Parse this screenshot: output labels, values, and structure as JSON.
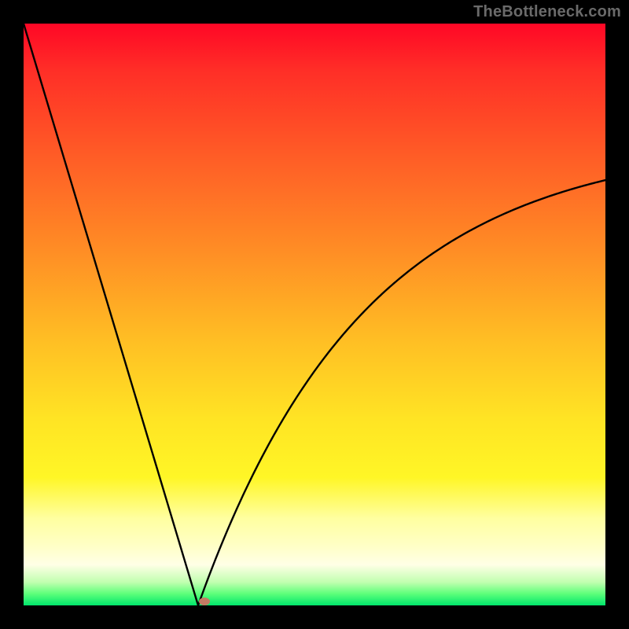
{
  "watermark": "TheBottleneck.com",
  "marker": {
    "x_frac": 0.311,
    "y_frac": 0.993
  },
  "chart_data": {
    "type": "line",
    "title": "",
    "xlabel": "",
    "ylabel": "",
    "xlim": [
      0,
      1
    ],
    "ylim": [
      0,
      1
    ],
    "x0": 0.3,
    "series": [
      {
        "name": "bottleneck-curve",
        "x": [
          0.0,
          0.05,
          0.1,
          0.15,
          0.2,
          0.25,
          0.28,
          0.3,
          0.32,
          0.35,
          0.4,
          0.45,
          0.5,
          0.55,
          0.6,
          0.65,
          0.7,
          0.75,
          0.8,
          0.85,
          0.9,
          0.95,
          1.0
        ],
        "y": [
          1.0,
          0.84,
          0.67,
          0.5,
          0.33,
          0.17,
          0.07,
          0.0,
          0.07,
          0.18,
          0.33,
          0.44,
          0.53,
          0.6,
          0.65,
          0.69,
          0.72,
          0.74,
          0.76,
          0.77,
          0.78,
          0.79,
          0.8
        ]
      }
    ],
    "annotations": [
      {
        "name": "minimum-marker",
        "x": 0.311,
        "y": 0.007
      }
    ]
  }
}
